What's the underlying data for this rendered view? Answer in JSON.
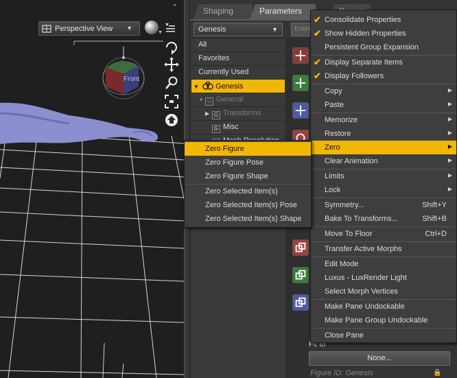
{
  "viewport": {
    "view_label": "Perspective View",
    "cube_label": "Front"
  },
  "pane": {
    "tabs": [
      "Shaping",
      "Parameters",
      "Posing"
    ],
    "node_select": "Genesis",
    "filter_placeholder": "Enter",
    "tree": [
      {
        "label": "All"
      },
      {
        "label": "Favorites"
      },
      {
        "label": "Currently Used"
      },
      {
        "label": "Genesis"
      },
      {
        "label": "General"
      },
      {
        "label": "Transforms"
      },
      {
        "label": "Misc"
      },
      {
        "label": "Mesh Resolution"
      }
    ],
    "fit_label": "Fit to",
    "fit_button": "None...",
    "figure_id": "Figure ID: Genesis"
  },
  "main_menu": [
    {
      "label": "Consolidate Properties",
      "checked": true
    },
    {
      "label": "Show Hidden Properties",
      "checked": true
    },
    {
      "label": "Persistent Group Expansion"
    },
    {
      "label": "Display Separate Items",
      "checked": true
    },
    {
      "label": "Display Followers",
      "checked": true
    },
    {
      "label": "Copy"
    },
    {
      "label": "Paste"
    },
    {
      "label": "Memorize"
    },
    {
      "label": "Restore"
    },
    {
      "label": "Zero"
    },
    {
      "label": "Clear Animation"
    },
    {
      "label": "Limits"
    },
    {
      "label": "Lock"
    },
    {
      "label": "Symmetry...",
      "shortcut": "Shift+Y"
    },
    {
      "label": "Bake To Transforms...",
      "shortcut": "Shift+B"
    },
    {
      "label": "Move To Floor",
      "shortcut": "Ctrl+D"
    },
    {
      "label": "Transfer Active Morphs"
    },
    {
      "label": "Edit Mode"
    },
    {
      "label": "Luxus - LuxRender Light"
    },
    {
      "label": "Select Morph Vertices"
    },
    {
      "label": "Make Pane Undockable"
    },
    {
      "label": "Make Pane Group Undockable"
    },
    {
      "label": "Close Pane"
    }
  ],
  "zero_submenu": [
    {
      "label": "Zero Figure"
    },
    {
      "label": "Zero Figure Pose"
    },
    {
      "label": "Zero Figure Shape"
    },
    {
      "label": "Zero Selected Item(s)"
    },
    {
      "label": "Zero Selected Item(s) Pose"
    },
    {
      "label": "Zero Selected Item(s) Shape"
    }
  ],
  "colors": {
    "accent": "#f2b705",
    "menu_bg": "#3e3e3e",
    "viewport_bg": "#1f1f1f",
    "figure_skin": "#8b8fd0"
  },
  "icons": [
    "view-icon",
    "sphere-icon",
    "viewport-menu-icon",
    "orbit-icon",
    "pan-icon",
    "zoom-icon",
    "frame-icon",
    "home-icon",
    "checkmark-icon",
    "submenu-arrow-icon",
    "lock-icon"
  ]
}
